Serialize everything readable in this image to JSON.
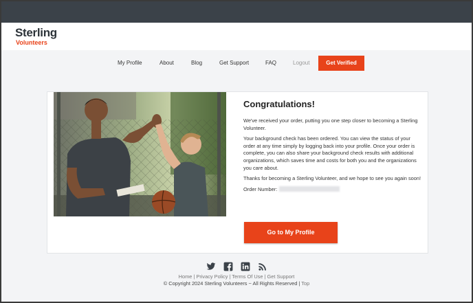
{
  "brand": {
    "name": "Sterling",
    "sub": "Volunteers",
    "accent": "#e8431a"
  },
  "nav": {
    "items": [
      "My Profile",
      "About",
      "Blog",
      "Get Support",
      "FAQ",
      "Logout"
    ],
    "cta": "Get Verified"
  },
  "main": {
    "title": "Congratulations!",
    "paragraphs": [
      "We've received your order, putting you one step closer to becoming a Sterling Volunteer.",
      "Your background check has been ordered. You can view the status of your order at any time simply by logging back into your profile. Once your order is complete, you can also share your background check results with additional organizations, which saves time and costs for both you and the organizations you care about.",
      "Thanks for becoming a Sterling Volunteer, and we hope to see you again soon!"
    ],
    "order_label": "Order Number:",
    "button": "Go to My Profile"
  },
  "footer": {
    "social": [
      "twitter-icon",
      "facebook-icon",
      "linkedin-icon",
      "rss-icon"
    ],
    "links": [
      "Home",
      "Privacy Policy",
      "Terms Of Use",
      "Get Support"
    ],
    "copyright": "© Copyright 2024 Sterling Volunteers ~ All Rights Reserved |",
    "top": "Top"
  }
}
